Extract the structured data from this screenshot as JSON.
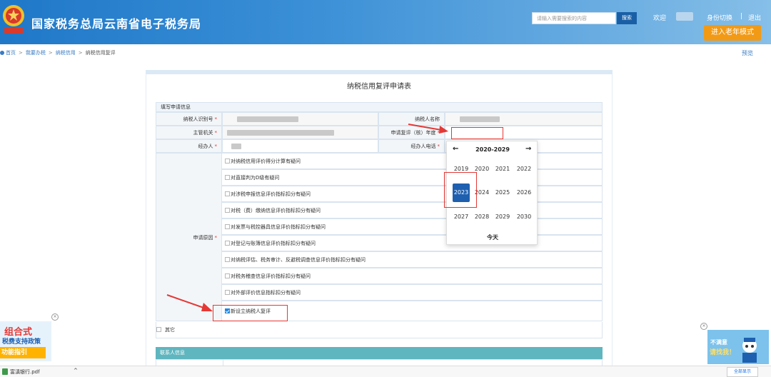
{
  "header": {
    "title": "国家税务总局云南省电子税务局",
    "search_placeholder": "请输入需要搜索的内容",
    "search_button": "搜索",
    "welcome": "欢迎",
    "switch_identity": "身份切换",
    "separator": "|",
    "logout": "退出",
    "elder_mode": "进入老年模式"
  },
  "breadcrumb": {
    "items": [
      "首页",
      "我要办税",
      "纳税信用",
      "纳税信用复评"
    ],
    "separator": ">"
  },
  "preview": "预览",
  "form": {
    "title": "纳税信用复评申请表",
    "section_fill": "填写申请信息",
    "fields": {
      "taxpayer_id_label": "纳税人识别号",
      "taxpayer_name_label": "纳税人名称",
      "authority_label": "主管机关",
      "review_year_label": "申请复评（核）年度",
      "handler_label": "经办人",
      "handler_phone_label": "经办人电话",
      "required_mark": "*"
    },
    "reason_label": "申请原因",
    "reasons": [
      {
        "label": "对纳税信用评价得分计算有疑问",
        "checked": false
      },
      {
        "label": "对直接判为D级有疑问",
        "checked": false
      },
      {
        "label": "对涉税申报信息评价指标扣分有疑问",
        "checked": false
      },
      {
        "label": "对税（费）缴纳信息评价指标扣分有疑问",
        "checked": false
      },
      {
        "label": "对发票与税控器具信息评价指标扣分有疑问",
        "checked": false
      },
      {
        "label": "对登记与账簿信息评价指标扣分有疑问",
        "checked": false
      },
      {
        "label": "对纳税评估、税务审计、反避税调查信息评价指标扣分有疑问",
        "checked": false
      },
      {
        "label": "对税务稽查信息评价指标扣分有疑问",
        "checked": false
      },
      {
        "label": "对外部评价信息指标扣分有疑问",
        "checked": false
      },
      {
        "label": "新设立纳税人复评",
        "checked": true
      }
    ],
    "other_label": "其它",
    "contact_section": "联系人信息"
  },
  "calendar": {
    "prev": "←",
    "next": "→",
    "range": "2020-2029",
    "years": [
      "2019",
      "2020",
      "2021",
      "2022",
      "2023",
      "2024",
      "2025",
      "2026",
      "2027",
      "2028",
      "2029",
      "2030"
    ],
    "selected": "2023",
    "today": "今天"
  },
  "ads": {
    "left": {
      "line1": "组合式",
      "line2": "税费支持政策",
      "line3": "功能指引"
    },
    "right": {
      "line1": "不满意",
      "line2": "请找我！"
    },
    "close": "×"
  },
  "download_bar": {
    "file_name": "富滇银行.pdf",
    "caret": "^",
    "show_all": "全部显示"
  },
  "colors": {
    "header_blue": "#1f78c8",
    "accent_orange": "#f29a16",
    "selected_year": "#1e5fb0",
    "annotation_red": "#e53935",
    "contact_header": "#5fb6bf"
  }
}
